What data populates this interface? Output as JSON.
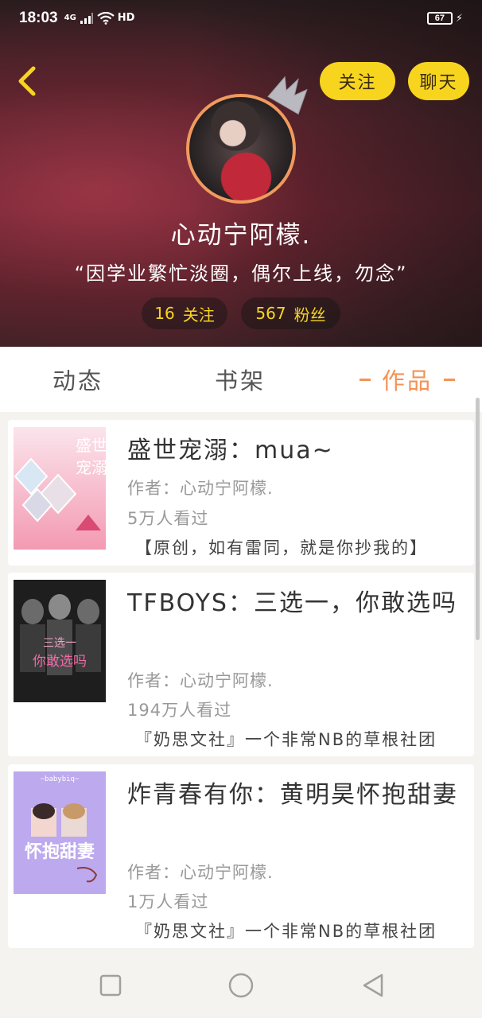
{
  "status_bar": {
    "time": "18:03",
    "network": "4G",
    "hd": "HD",
    "battery": "67"
  },
  "header": {
    "follow_label": "关注",
    "chat_label": "聊天",
    "username": "心动宁阿檬.",
    "bio": "“因学业繁忙淡圈，偶尔上线，勿念”",
    "following_count": "16",
    "following_label": "关注",
    "fans_count": "567",
    "fans_label": "粉丝",
    "avatar_border_color": "#f09a5e",
    "button_color": "#f7d51f"
  },
  "tabs": [
    {
      "label": "动态",
      "active": false
    },
    {
      "label": "书架",
      "active": false
    },
    {
      "label": "作品",
      "active": true
    }
  ],
  "accent_color": "#f39355",
  "works": [
    {
      "title": "盛世宠溺：mua~",
      "author": "作者：心动宁阿檬.",
      "views": "5万人看过",
      "intro": "【原创，如有雷同，就是你抄我的】"
    },
    {
      "title": "TFBOYS：三选一，你敢选吗",
      "author": "作者：心动宁阿檬.",
      "views": "194万人看过",
      "intro": "『奶思文社』一个非常NB的草根社团"
    },
    {
      "title": "炸青春有你：黄明昊怀抱甜妻",
      "author": "作者：心动宁阿檬.",
      "views": "1万人看过",
      "intro": "『奶思文社』一个非常NB的草根社团"
    }
  ],
  "covers": [
    {
      "text_top": "盛世",
      "text_mid": "宠溺"
    },
    {
      "text_top": "三选一",
      "text_mid": "你敢选吗"
    },
    {
      "text_top": "~babybiq~",
      "text_mid": "怀抱甜妻"
    }
  ]
}
